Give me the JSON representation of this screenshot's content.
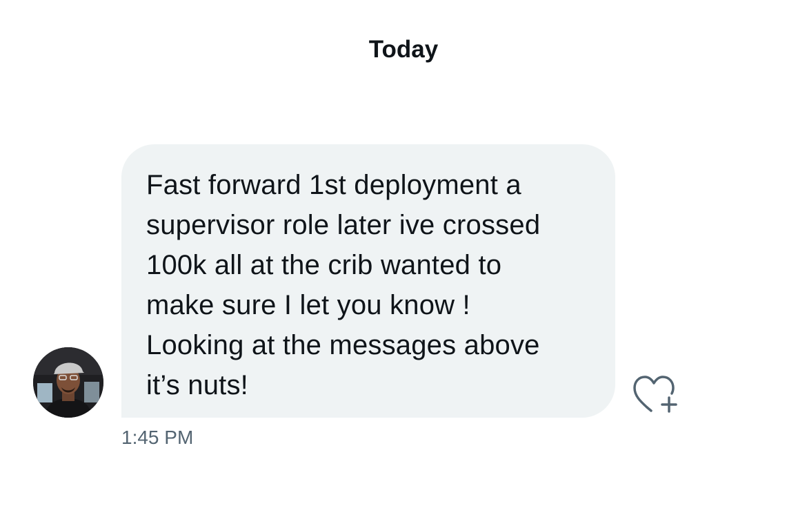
{
  "conversation": {
    "date_header": "Today",
    "messages": [
      {
        "text": "Fast forward 1st deployment a\nsupervisor role later ive crossed\n100k all at the crib wanted to\nmake sure I let you know !\nLooking at the messages above\nit’s nuts!",
        "timestamp": "1:45 PM",
        "sender_avatar_icon": "user-avatar",
        "reaction_icon": "heart-add-icon"
      }
    ]
  },
  "colors": {
    "bubble_background": "#eff3f4",
    "text_primary": "#0f1419",
    "text_secondary": "#536471",
    "icon": "#536471"
  }
}
